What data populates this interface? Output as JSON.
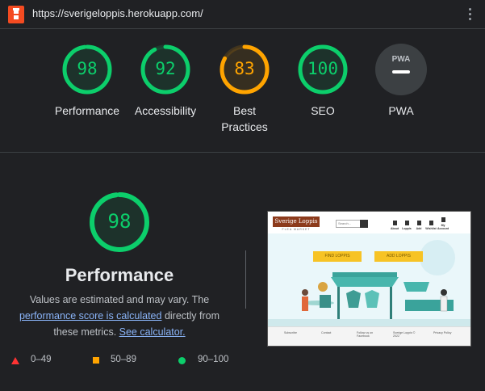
{
  "topbar": {
    "url": "https://sverigeloppis.herokuapp.com/"
  },
  "gauges": [
    {
      "label": "Performance",
      "score": "98",
      "value": 98
    },
    {
      "label": "Accessibility",
      "score": "92",
      "value": 92
    },
    {
      "label": "Best Practices",
      "score": "83",
      "value": 83
    },
    {
      "label": "SEO",
      "score": "100",
      "value": 100
    },
    {
      "label": "PWA",
      "score": "",
      "value": null,
      "badge_text": "PWA"
    }
  ],
  "colors": {
    "pass": "#0cce6b",
    "average": "#ffa400",
    "fail": "#ff3333",
    "na": "#5f6368"
  },
  "performance": {
    "score": "98",
    "value": 98,
    "title": "Performance",
    "desc_1": "Values are estimated and may vary. The ",
    "desc_link_1": "performance score is calculated",
    "desc_2": " directly from these metrics. ",
    "desc_link_2": "See calculator."
  },
  "legend": [
    {
      "range": "0–49",
      "icon": "triangle-icon"
    },
    {
      "range": "50–89",
      "icon": "square-icon"
    },
    {
      "range": "90–100",
      "icon": "circle-icon"
    }
  ],
  "thumbnail": {
    "brand": "Sverige Loppis",
    "tagline": "FLEA MARKET",
    "search_placeholder": "Search...",
    "nav": [
      "About",
      "Loppis",
      "Add",
      "Wishlist",
      "My Account"
    ],
    "find_button": "FIND LOPPIS",
    "add_button": "ADD LOPPIS",
    "footer": [
      "Subscribe",
      "Contact",
      "Follow us on Facebook",
      "Sverige Loppis © 2022",
      "Privacy Policy"
    ]
  }
}
